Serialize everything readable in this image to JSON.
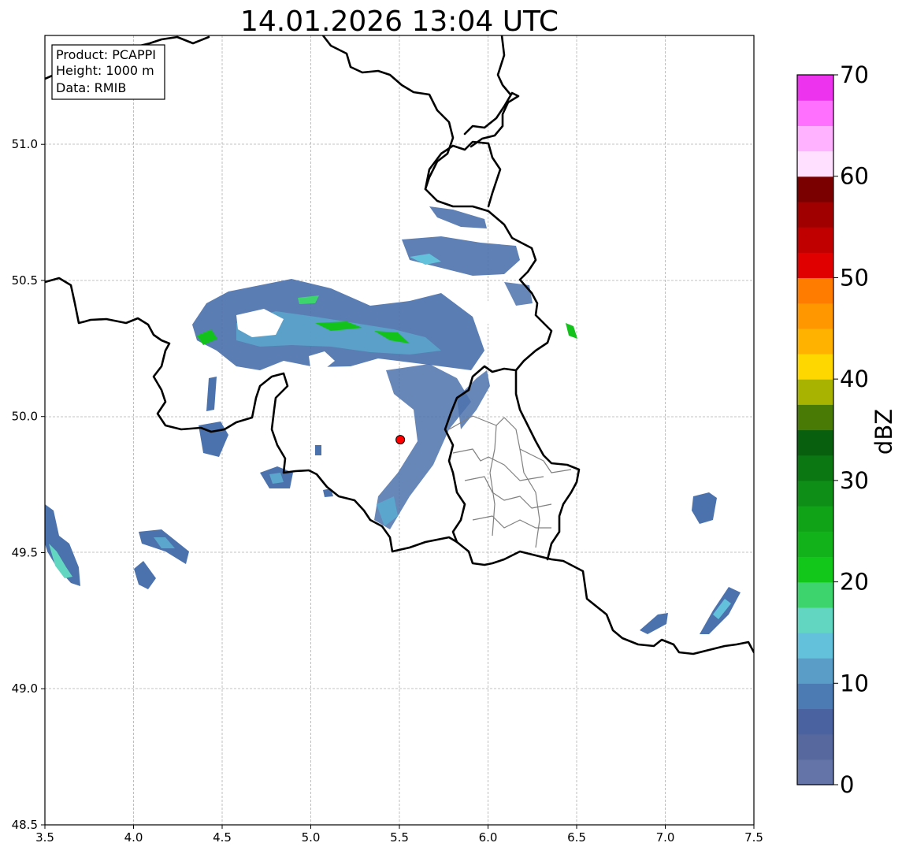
{
  "title": "14.01.2026 13:04 UTC",
  "info_box": {
    "product": "Product: PCAPPI",
    "height": "Height: 1000 m",
    "data": "Data: RMIB"
  },
  "map": {
    "lon_range": [
      3.5,
      7.5
    ],
    "lat_range": [
      48.5,
      51.4
    ],
    "x_ticks": [
      "3.5",
      "4.0",
      "4.5",
      "5.0",
      "5.5",
      "6.0",
      "6.5",
      "7.0",
      "7.5"
    ],
    "y_ticks": [
      "48.5",
      "49.0",
      "49.5",
      "50.0",
      "50.5",
      "51.0"
    ],
    "radar_site": {
      "lon": 5.505,
      "lat": 49.915,
      "color": "#ff0000"
    },
    "grid": true
  },
  "colorbar": {
    "label": "dBZ",
    "min": 0,
    "max": 70,
    "ticks": [
      "0",
      "10",
      "20",
      "30",
      "40",
      "50",
      "60",
      "70"
    ],
    "colors": [
      "#6474a8",
      "#56689e",
      "#4a63a0",
      "#4c7ab2",
      "#5a9ec8",
      "#63c1dc",
      "#63d6c2",
      "#3dd36d",
      "#12c61a",
      "#12b21a",
      "#10a318",
      "#0e8e16",
      "#0b7713",
      "#08600e",
      "#4a7a06",
      "#a8b200",
      "#ffd700",
      "#ffb200",
      "#ff9700",
      "#ff7c00",
      "#e10000",
      "#c00000",
      "#a00000",
      "#7a0000",
      "#ffe0ff",
      "#ffb2ff",
      "#ff70ff",
      "#ee33ee"
    ]
  }
}
